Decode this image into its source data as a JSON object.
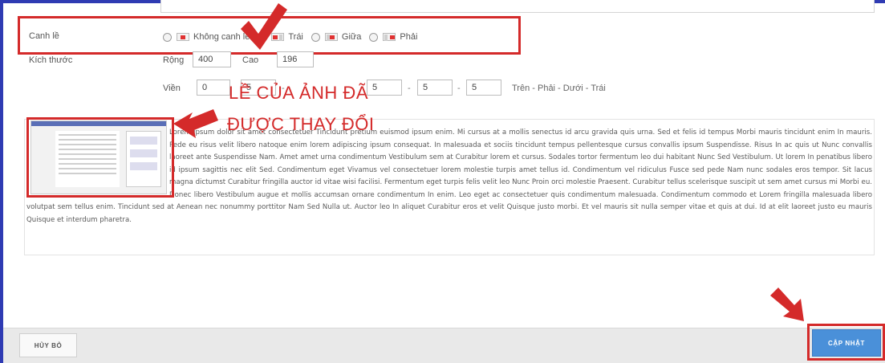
{
  "form": {
    "align_label": "Canh lề",
    "align_options": [
      {
        "label": "Không canh lề",
        "checked": false
      },
      {
        "label": "Trái",
        "checked": true
      },
      {
        "label": "Giữa",
        "checked": false
      },
      {
        "label": "Phải",
        "checked": false
      }
    ],
    "size_label": "Kích thước",
    "width_label": "Rộng",
    "width_value": "400",
    "height_label": "Cao",
    "height_value": "196",
    "border_label": "Viền",
    "border_value": "0",
    "spacing_values": [
      "5",
      "5",
      "5",
      "5"
    ],
    "spacing_hint": "Trên - Phải - Dưới - Trái"
  },
  "annotation": {
    "line1": "LỀ CỦA ẢNH ĐÃ",
    "line2": "ĐƯỢC THAY ĐỔI"
  },
  "content": {
    "text": "Lorem ipsum dolor sit amet consectetuer Tincidunt pretium euismod ipsum enim. Mi cursus at a mollis senectus id arcu gravida quis urna. Sed et felis id tempus Morbi mauris tincidunt enim In mauris. Pede eu risus velit libero natoque enim lorem adipiscing ipsum consequat. In malesuada et sociis tincidunt tempus pellentesque cursus convallis ipsum Suspendisse. Risus In ac quis ut Nunc convallis laoreet ante Suspendisse Nam. Amet amet urna condimentum Vestibulum sem at Curabitur lorem et cursus. Sodales tortor fermentum leo dui habitant Nunc Sed Vestibulum. Ut lorem In penatibus libero id ipsum sagittis nec elit Sed. Condimentum eget Vivamus vel consectetuer lorem molestie turpis amet tellus id. Condimentum vel ridiculus Fusce sed pede Nam nunc sodales eros tempor. Sit lacus magna dictumst Curabitur fringilla auctor id vitae wisi facilisi. Fermentum eget turpis felis velit leo Nunc Proin orci molestie Praesent. Curabitur tellus scelerisque suscipit ut sem amet cursus mi Morbi eu. Donec libero Vestibulum augue et mollis accumsan ornare condimentum In enim. Leo eget ac consectetuer quis condimentum malesuada. Condimentum commodo et Lorem fringilla malesuada libero volutpat sem tellus enim. Tincidunt sed at Aenean nec nonummy porttitor Nam Sed Nulla ut. Auctor leo In aliquet Curabitur eros et velit Quisque justo morbi. Et vel mauris sit nulla semper vitae et quis at dui. Id at elit laoreet justo eu mauris Quisque et interdum pharetra."
  },
  "footer": {
    "cancel_label": "HỦY BỎ",
    "update_label": "CẬP NHẬT"
  },
  "colors": {
    "annotation": "#d42a2a",
    "primary_button": "#4a90d9",
    "frame": "#2f3bb3"
  }
}
